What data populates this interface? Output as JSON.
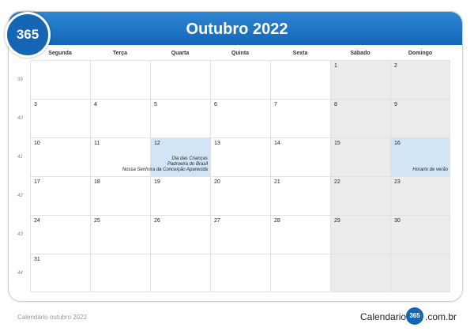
{
  "logo_text": "365",
  "title": "Outubro 2022",
  "weekdays": [
    "Segunda",
    "Terça",
    "Quarta",
    "Quinta",
    "Sexta",
    "Sábado",
    "Domingo"
  ],
  "weeks": [
    {
      "number": "39",
      "days": [
        "",
        "",
        "",
        "",
        "",
        "1",
        "2"
      ]
    },
    {
      "number": "40",
      "days": [
        "3",
        "4",
        "5",
        "6",
        "7",
        "8",
        "9"
      ]
    },
    {
      "number": "41",
      "days": [
        "10",
        "11",
        "12",
        "13",
        "14",
        "15",
        "16"
      ]
    },
    {
      "number": "42",
      "days": [
        "17",
        "18",
        "19",
        "20",
        "21",
        "22",
        "23"
      ]
    },
    {
      "number": "43",
      "days": [
        "24",
        "25",
        "26",
        "27",
        "28",
        "29",
        "30"
      ]
    },
    {
      "number": "44",
      "days": [
        "31",
        "",
        "",
        "",
        "",
        "",
        ""
      ]
    }
  ],
  "events": {
    "day12": [
      "Dia das Crianças",
      "Padroeira do Brasil",
      "Nossa Senhora da Conceição Aparecida"
    ],
    "day16": [
      "Horario de verão"
    ]
  },
  "colors": {
    "header": "#1a6fc0",
    "holiday": "#d2e5f7",
    "weekend": "#ececec"
  },
  "footer": {
    "left": "Calendário outubro 2022",
    "brand_left": "Calendario",
    "brand_circle": "365",
    "brand_right": ".com.br"
  }
}
